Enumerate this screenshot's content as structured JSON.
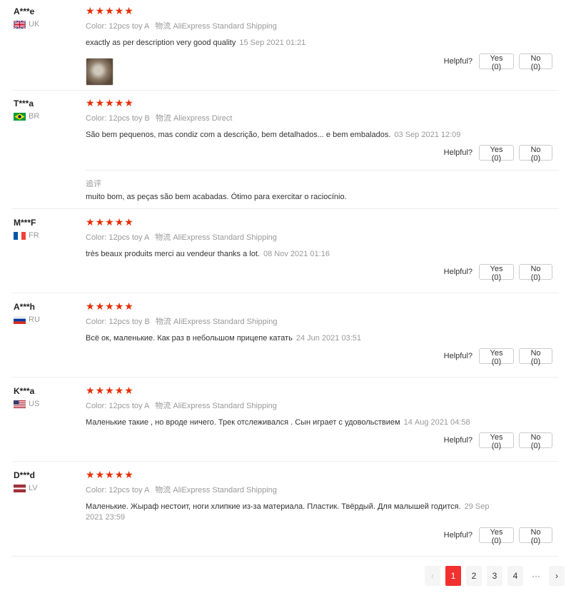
{
  "labels": {
    "helpful": "Helpful?",
    "color": "Color:",
    "star": "★"
  },
  "reviews": [
    {
      "user": "A***e",
      "country": "UK",
      "flag": "uk",
      "color": "12pcs toy A",
      "shipping": "物流 AliExpress Standard Shipping",
      "text": "exactly as per description very good quality",
      "date": "15 Sep 2021 01:21",
      "yes": "Yes (0)",
      "no": "No (0)"
    },
    {
      "user": "T***a",
      "country": "BR",
      "flag": "br",
      "color": "12pcs toy B",
      "shipping": "物流 Aliexpress Direct",
      "text": "São bem pequenos, mas condiz com a descrição, bem detalhados... e bem embalados.",
      "date": "03 Sep 2021 12:09",
      "yes": "Yes (0)",
      "no": "No (0)",
      "followup_label": "追评",
      "followup_text": "muito bom, as peças são bem acabadas. Ótimo para exercitar o raciocínio."
    },
    {
      "user": "M***F",
      "country": "FR",
      "flag": "fr",
      "color": "12pcs toy A",
      "shipping": "物流 AliExpress Standard Shipping",
      "text": "très beaux produits merci au vendeur thanks a lot.",
      "date": "08 Nov 2021 01:16",
      "yes": "Yes (0)",
      "no": "No (0)"
    },
    {
      "user": "A***h",
      "country": "RU",
      "flag": "ru",
      "color": "12pcs toy B",
      "shipping": "物流 AliExpress Standard Shipping",
      "text": "Всё ок, маленькие. Как раз в небольшом прицепе катать",
      "date": "24 Jun 2021 03:51",
      "yes": "Yes (0)",
      "no": "No (0)"
    },
    {
      "user": "K***a",
      "country": "US",
      "flag": "us",
      "color": "12pcs toy A",
      "shipping": "物流 AliExpress Standard Shipping",
      "text": "Маленькие такие , но вроде ничего. Трек отслеживался . Сын играет с удовольствием",
      "date": "14 Aug 2021 04:58",
      "yes": "Yes (0)",
      "no": "No (0)"
    },
    {
      "user": "D***d",
      "country": "LV",
      "flag": "lv",
      "color": "12pcs toy A",
      "shipping": "物流 AliExpress Standard Shipping",
      "text": "Маленькие. Жыраф нестоит, ноги хлипкие из-за материала. Пластик. Твёрдый. Для малышей годится.",
      "date": "29 Sep 2021 23:59",
      "yes": "Yes (0)",
      "no": "No (0)"
    }
  ],
  "pagination": {
    "prev": "‹",
    "pages": [
      "1",
      "2",
      "3",
      "4"
    ],
    "ellipsis": "···",
    "next": "›",
    "current": "1"
  },
  "colors": {
    "star": "#e62e04",
    "active_page": "#f23030"
  }
}
